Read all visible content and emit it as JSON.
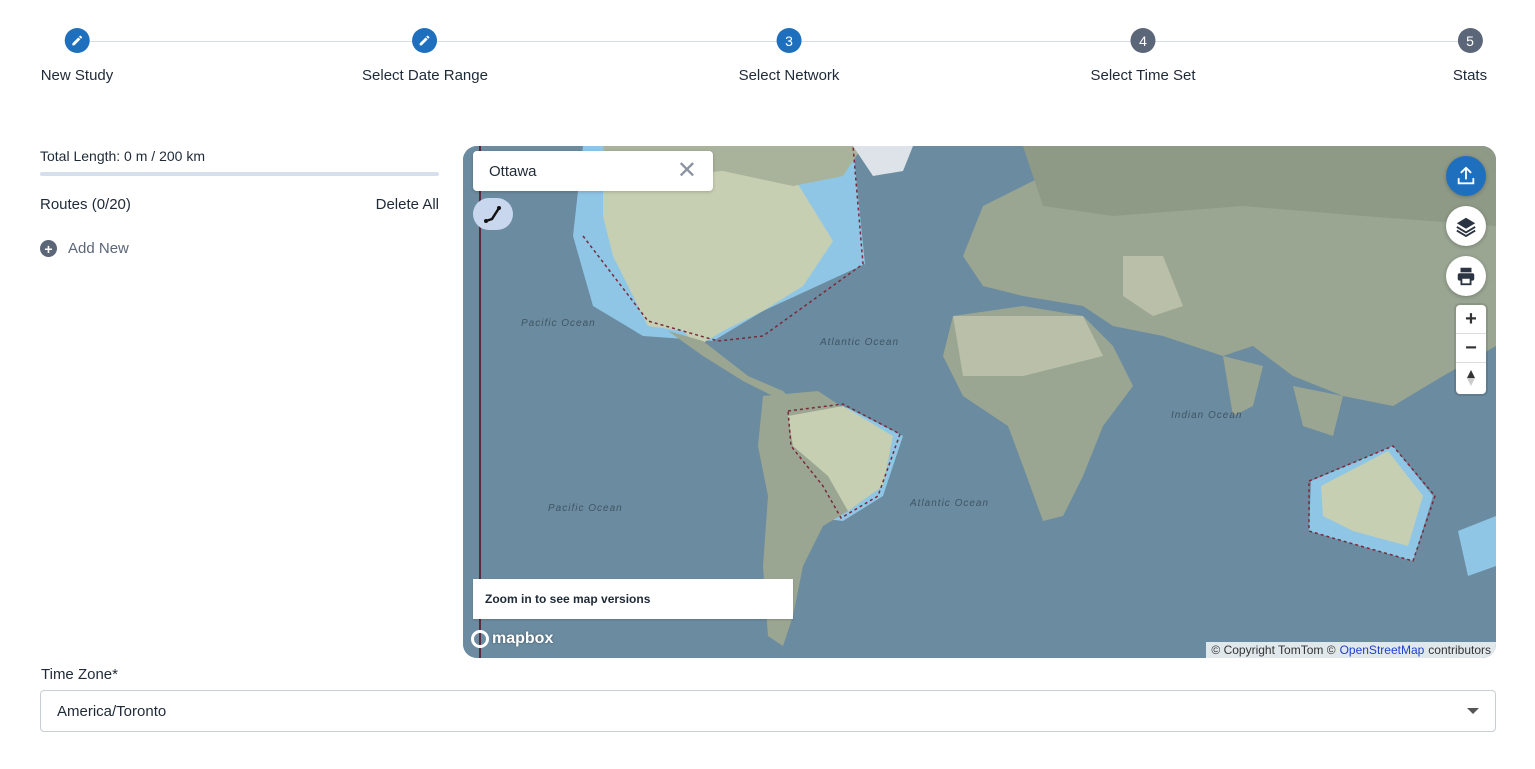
{
  "stepper": {
    "steps": [
      {
        "label": "New Study",
        "marker": "pencil-icon",
        "state": "done"
      },
      {
        "label": "Select Date Range",
        "marker": "pencil-icon",
        "state": "done"
      },
      {
        "label": "Select Network",
        "number": "3",
        "state": "active"
      },
      {
        "label": "Select Time Set",
        "number": "4",
        "state": "todo"
      },
      {
        "label": "Stats",
        "number": "5",
        "state": "todo"
      }
    ]
  },
  "left": {
    "total_length": "Total Length: 0 m / 200 km",
    "routes_title": "Routes (0/20)",
    "delete_all": "Delete All",
    "add_new": "Add New"
  },
  "map": {
    "search_value": "Ottawa",
    "versions_notice": "Zoom in to see map versions",
    "logo": "mapbox",
    "attribution_pre": "© Copyright TomTom ©",
    "attribution_link": "OpenStreetMap",
    "attribution_post": "contributors",
    "ocean_labels": [
      "Pacific Ocean",
      "Atlantic Ocean",
      "Indian Ocean",
      "Pacific Ocean",
      "Atlantic Ocean"
    ],
    "zoom_in": "+",
    "zoom_out": "−",
    "colors": {
      "water": "#6b8ba0",
      "land": "#9aa692",
      "brand": "#1f6fbf"
    }
  },
  "timezone": {
    "label": "Time Zone*",
    "value": "America/Toronto"
  }
}
